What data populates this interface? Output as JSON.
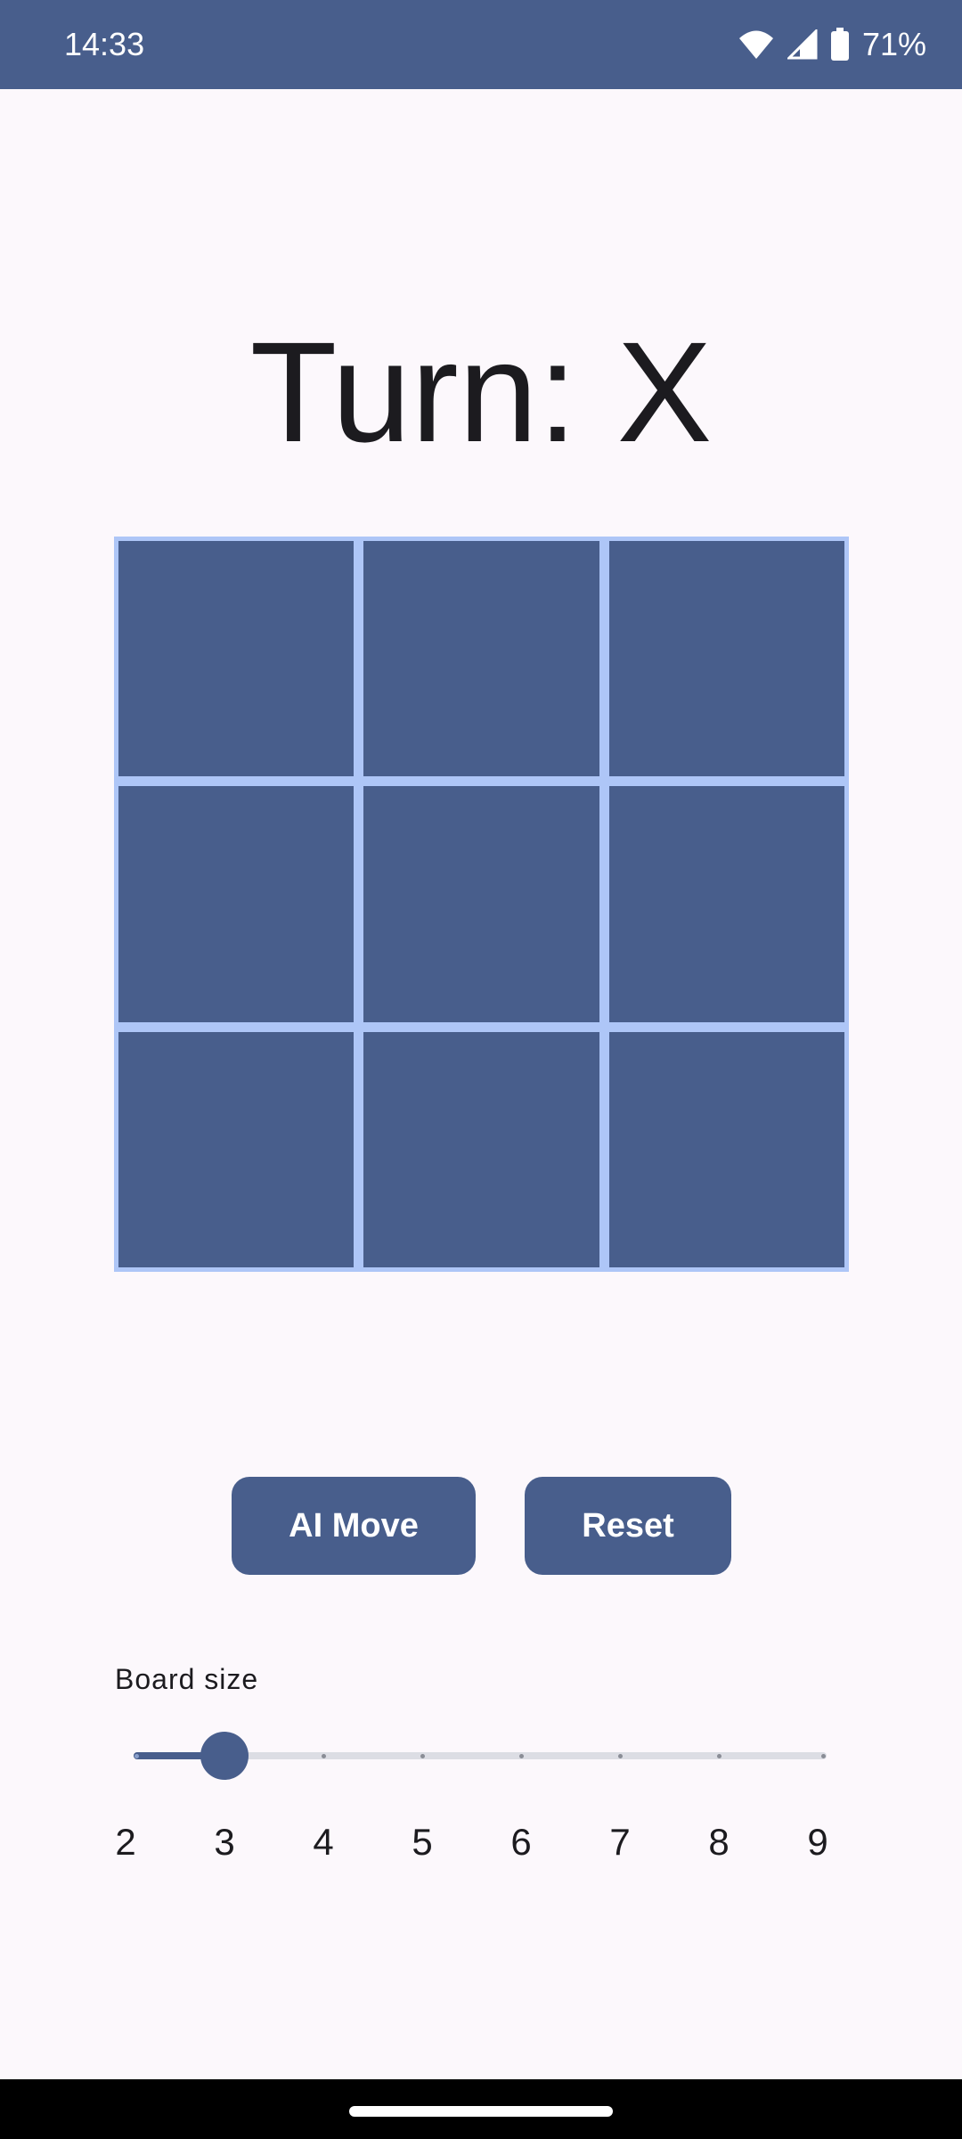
{
  "status_bar": {
    "time": "14:33",
    "battery_percent": "71%",
    "icons": [
      "wifi-icon",
      "cell-signal-icon",
      "battery-icon"
    ]
  },
  "game": {
    "turn_label": "Turn: X",
    "board_size": 3,
    "cells": [
      "",
      "",
      "",
      "",
      "",
      "",
      "",
      "",
      ""
    ]
  },
  "buttons": {
    "ai_move": "AI Move",
    "reset": "Reset"
  },
  "board_size_slider": {
    "label": "Board size",
    "min": 2,
    "max": 9,
    "value": 3,
    "scale": [
      "2",
      "3",
      "4",
      "5",
      "6",
      "7",
      "8",
      "9"
    ]
  },
  "colors": {
    "primary": "#485e8c",
    "grid_lines": "#aec6f7",
    "background": "#fcf8fc",
    "track_inactive": "#dcdde4"
  }
}
